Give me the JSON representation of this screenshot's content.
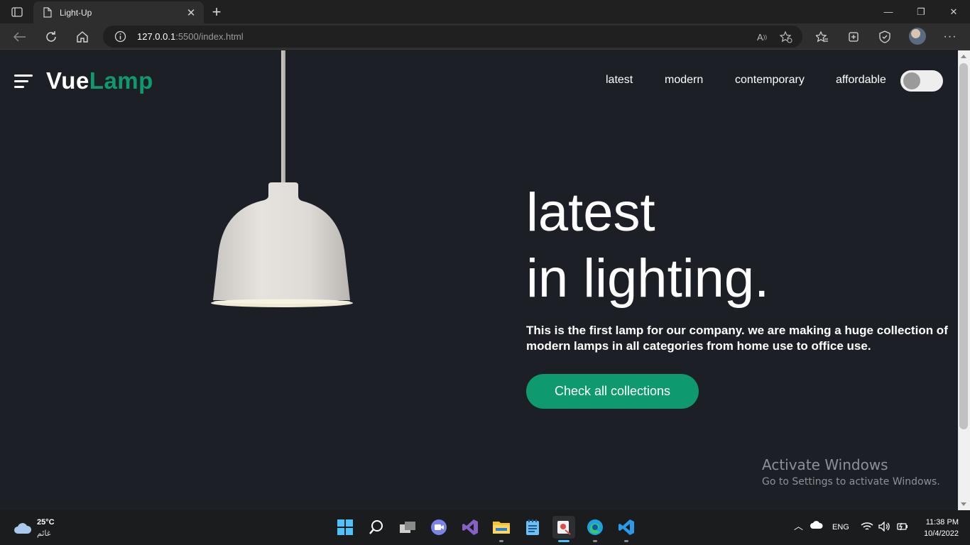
{
  "browser": {
    "tab_title": "Light-Up",
    "tab_close": "✕",
    "new_tab": "+",
    "window_controls": {
      "minimize": "—",
      "restore": "❐",
      "close": "✕"
    },
    "address": {
      "host": "127.0.0.1",
      "path": ":5500/index.html"
    },
    "icons": [
      "tab-actions-icon",
      "page-icon",
      "back-icon",
      "refresh-icon",
      "home-icon",
      "info-icon",
      "read-aloud-icon",
      "add-favorite-icon",
      "favorites-icon",
      "collections-icon",
      "browser-essentials-icon",
      "profile-avatar",
      "more-icon"
    ]
  },
  "site": {
    "logo_part1": "Vue",
    "logo_part2": "Lamp",
    "nav": [
      {
        "label": "latest"
      },
      {
        "label": "modern"
      },
      {
        "label": "contemporary"
      },
      {
        "label": "affordable"
      }
    ],
    "headline_line1": "latest",
    "headline_line2": "in lighting.",
    "description": "This is the first lamp for our company. we are making a huge collection of modern lamps in all categories from home use to office use.",
    "cta_label": "Check all collections",
    "colors": {
      "background": "#1c1f26",
      "accent": "#0e9a6e",
      "text": "#ffffff"
    }
  },
  "watermark": {
    "title": "Activate Windows",
    "subtitle": "Go to Settings to activate Windows."
  },
  "taskbar": {
    "weather_temp": "25°C",
    "weather_desc": "غائم",
    "apps": [
      "start-icon",
      "search-icon",
      "task-view-icon",
      "teams-chat-icon",
      "visual-studio-icon",
      "file-explorer-icon",
      "notepad-icon",
      "snipping-tool-icon",
      "edge-icon",
      "vscode-icon"
    ],
    "language": "ENG",
    "time": "11:38 PM",
    "date": "10/4/2022"
  }
}
